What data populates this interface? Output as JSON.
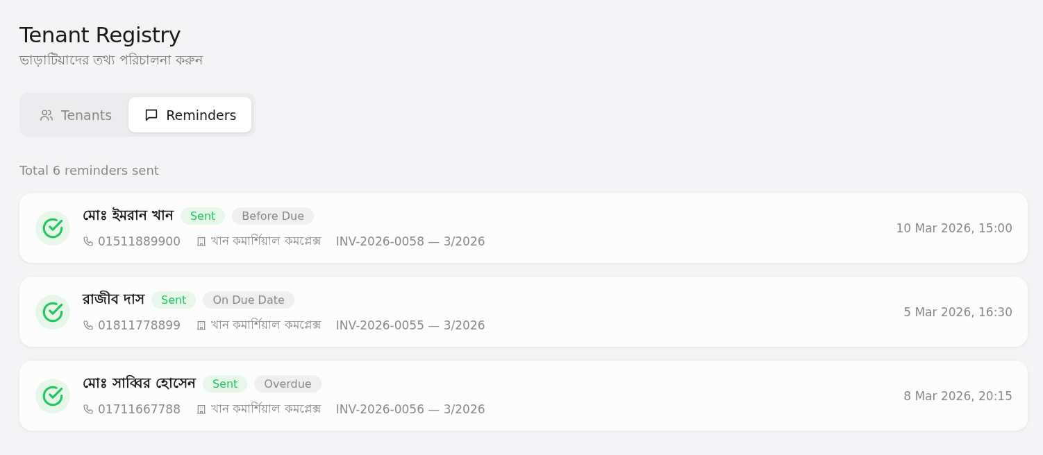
{
  "header": {
    "title": "Tenant Registry",
    "subtitle": "ভাড়াটিয়াদের তথ্য পরিচালনা করুন"
  },
  "tabs": [
    {
      "label": "Tenants",
      "kind": "users",
      "selected": false
    },
    {
      "label": "Reminders",
      "kind": "message",
      "selected": true
    }
  ],
  "summary": "Total 6 reminders sent",
  "reminders": [
    {
      "name": "মোঃ ইমরান খান",
      "status": "Sent",
      "kind": "sent",
      "timing": "Before Due",
      "phone": "01511889900",
      "property": "খান কমার্শিয়াল কমপ্লেক্স",
      "invoice": "INV-2026-0058 — 3/2026",
      "sent_at": "10 Mar 2026, 15:00"
    },
    {
      "name": "রাজীব দাস",
      "status": "Sent",
      "kind": "sent",
      "timing": "On Due Date",
      "phone": "01811778899",
      "property": "খান কমার্শিয়াল কমপ্লেক্স",
      "invoice": "INV-2026-0055 — 3/2026",
      "sent_at": "5 Mar 2026, 16:30"
    },
    {
      "name": "মোঃ সাব্বির হোসেন",
      "status": "Sent",
      "kind": "sent",
      "timing": "Overdue",
      "phone": "01711667788",
      "property": "খান কমার্শিয়াল কমপ্লেক্স",
      "invoice": "INV-2026-0056 — 3/2026",
      "sent_at": "8 Mar 2026, 20:15"
    }
  ]
}
